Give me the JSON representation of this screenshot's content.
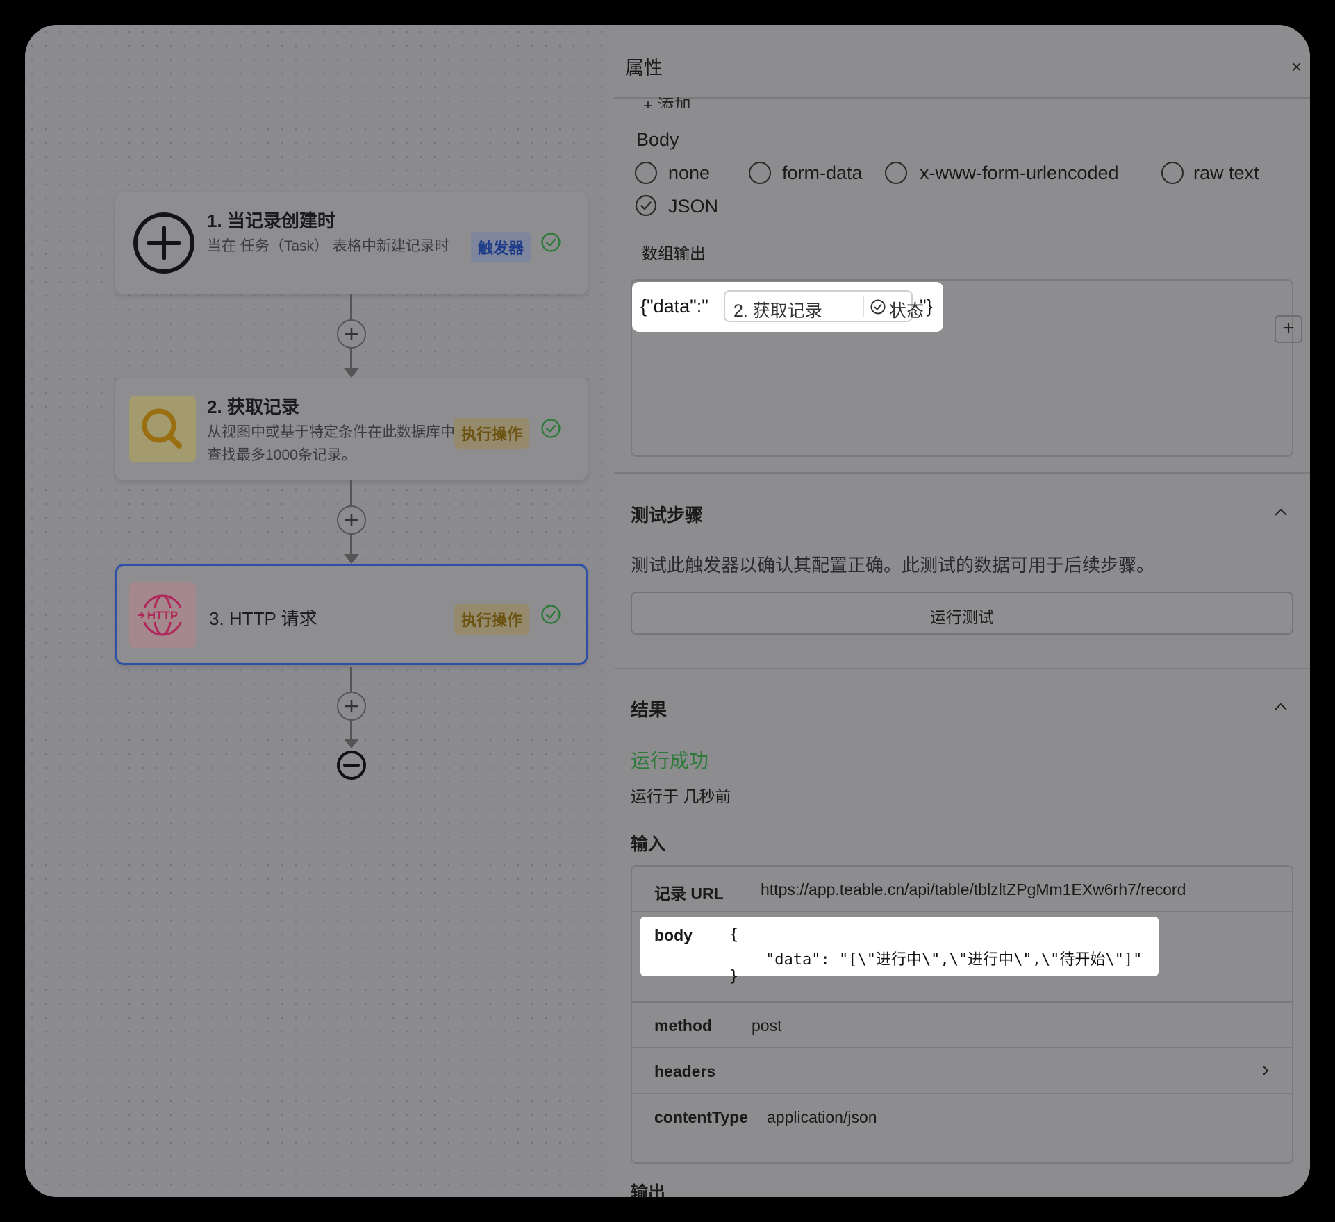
{
  "flow": {
    "nodes": [
      {
        "title": "1. 当记录创建时",
        "desc": "当在 任务（Task） 表格中新建记录时",
        "badge": "触发器"
      },
      {
        "title": "2. 获取记录",
        "desc": "从视图中或基于特定条件在此数据库中查找最多1000条记录。",
        "badge": "执行操作"
      },
      {
        "title": "3. HTTP 请求",
        "badge": "执行操作",
        "icon_text": "HTTP"
      }
    ]
  },
  "panel": {
    "title": "属性",
    "close": "×",
    "add_label": "+ 添加",
    "body_label": "Body",
    "body_options": [
      "none",
      "form-data",
      "x-www-form-urlencoded",
      "raw text",
      "JSON"
    ],
    "selected_option": "JSON",
    "array_output_label": "数组输出",
    "json_prefix": "{\"data\":\"",
    "token_step": "2. 获取记录",
    "token_field": "状态",
    "json_suffix": "\"}",
    "token_add": "+",
    "test": {
      "title": "测试步骤",
      "desc": "测试此触发器以确认其配置正确。此测试的数据可用于后续步骤。",
      "button": "运行测试"
    },
    "result": {
      "title": "结果",
      "status": "运行成功",
      "ran_at": "运行于 几秒前",
      "input_label": "输入",
      "rows": [
        {
          "key": "记录 URL",
          "value": "https://app.teable.cn/api/table/tblzltZPgMm1EXw6rh7/record"
        },
        {
          "key": "body",
          "value_lines": [
            "{",
            "    \"data\": \"[\\\"进行中\\\",\\\"进行中\\\",\\\"待开始\\\"]\"",
            "}"
          ]
        },
        {
          "key": "method",
          "value": "post"
        },
        {
          "key": "headers",
          "value": ""
        },
        {
          "key": "contentType",
          "value": "application/json"
        }
      ],
      "output_label": "输出"
    }
  },
  "colors": {
    "selected_border": "#2e4fa8",
    "success": "#2f7a3a",
    "trigger_badge": "#1e3b8a",
    "action_badge": "#6b5210"
  }
}
